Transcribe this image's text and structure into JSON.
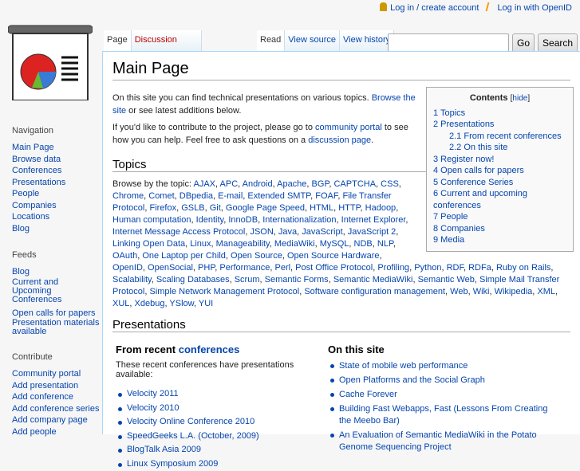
{
  "personal": {
    "login": "Log in / create account",
    "openid": "Log in with OpenID"
  },
  "tabs": {
    "page": "Page",
    "discussion": "Discussion",
    "read": "Read",
    "view_source": "View source",
    "view_history": "View history"
  },
  "search": {
    "value": "",
    "go": "Go",
    "search": "Search"
  },
  "title": "Main Page",
  "intro1": {
    "text": "On this site you can find technical presentations on various topics. ",
    "link": "Browse the site",
    "text2": " or see latest additions below."
  },
  "intro2": {
    "text": "If you'd like to contribute to the project, please go to ",
    "link": "community portal",
    "text2": " to see how you can help. Feel free to ask questions on a ",
    "link2": "discussion page",
    "text3": "."
  },
  "toc": {
    "title": "Contents",
    "hide": "hide",
    "items": [
      "1 Topics",
      "2 Presentations",
      "2.1 From recent conferences",
      "2.2 On this site",
      "3 Register now!",
      "4 Open calls for papers",
      "5 Conference Series",
      "6 Current and upcoming conferences",
      "7 People",
      "8 Companies",
      "9 Media"
    ]
  },
  "topics": {
    "heading": "Topics",
    "lead": "Browse by the topic: ",
    "items": [
      "AJAX",
      "APC",
      "Android",
      "Apache",
      "BGP",
      "CAPTCHA",
      "CSS",
      "Chrome",
      "Comet",
      "DBpedia",
      "E-mail",
      "Extended SMTP",
      "FOAF",
      "File Transfer Protocol",
      "Firefox",
      "GSLB",
      "Git",
      "Google Page Speed",
      "HTML",
      "HTTP",
      "Hadoop",
      "Human computation",
      "Identity",
      "InnoDB",
      "Internationalization",
      "Internet Explorer",
      "Internet Message Access Protocol",
      "JSON",
      "Java",
      "JavaScript",
      "JavaScript 2",
      "Linking Open Data",
      "Linux",
      "Manageability",
      "MediaWiki",
      "MySQL",
      "NDB",
      "NLP",
      "OAuth",
      "One Laptop per Child",
      "Open Source",
      "Open Source Hardware",
      "OpenID",
      "OpenSocial",
      "PHP",
      "Performance",
      "Perl",
      "Post Office Protocol",
      "Profiling",
      "Python",
      "RDF",
      "RDFa",
      "Ruby on Rails",
      "Scalability",
      "Scaling Databases",
      "Scrum",
      "Semantic Forms",
      "Semantic MediaWiki",
      "Semantic Web",
      "Simple Mail Transfer Protocol",
      "Simple Network Management Protocol",
      "Software configuration management",
      "Web",
      "Wiki",
      "Wikipedia",
      "XML",
      "XUL",
      "Xdebug",
      "YSlow",
      "YUI"
    ]
  },
  "presentations": {
    "heading": "Presentations",
    "recent": {
      "title": "From recent ",
      "title_link": "conferences",
      "desc": "These recent conferences have presentations available:",
      "items": [
        "Velocity 2011",
        "Velocity 2010",
        "Velocity Online Conference 2010",
        "SpeedGeeks L.A. (October, 2009)",
        "BlogTalk Asia 2009",
        "Linux Symposium 2009"
      ]
    },
    "site": {
      "title": "On this site",
      "items": [
        "State of mobile web performance",
        "Open Platforms and the Social Graph",
        "Cache Forever",
        "Building Fast Webapps, Fast (Lessons From Creating the Meebo Bar)",
        "An Evaluation of Semantic MediaWiki in the Potato Genome Sequencing Project"
      ]
    }
  },
  "sidebar": {
    "navigation": {
      "title": "Navigation",
      "items": [
        "Main Page",
        "Browse data",
        "Conferences",
        "Presentations",
        "People",
        "Companies",
        "Locations",
        "Blog"
      ]
    },
    "feeds": {
      "title": "Feeds",
      "items": [
        "Blog",
        "Current and Upcoming Conferences",
        "Open calls for papers",
        "Presentation materials available"
      ]
    },
    "contribute": {
      "title": "Contribute",
      "items": [
        "Community portal",
        "Add presentation",
        "Add conference",
        "Add conference series",
        "Add company page",
        "Add people"
      ]
    }
  }
}
